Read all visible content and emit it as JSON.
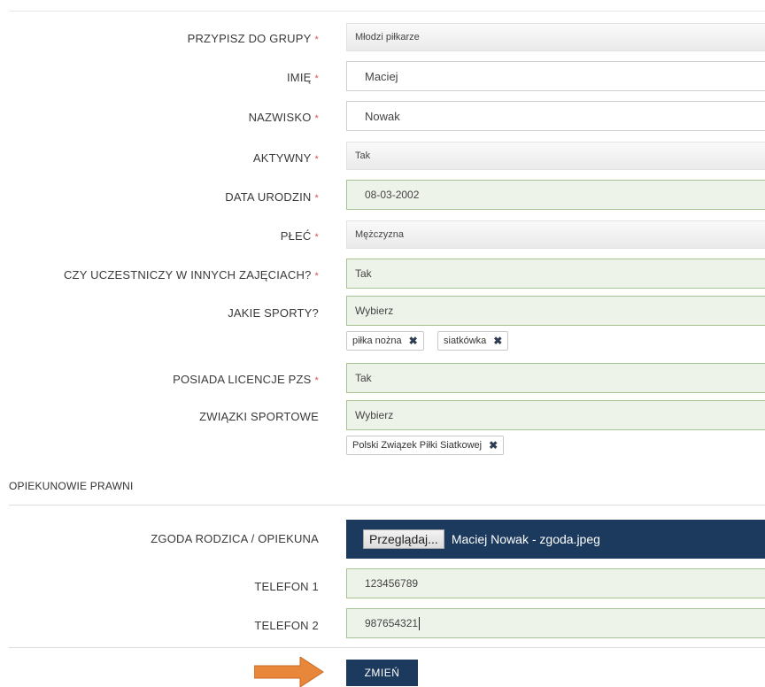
{
  "fields": {
    "group": {
      "label": "PRZYPISZ DO GRUPY",
      "required": "*",
      "value": "Młodzi piłkarze"
    },
    "first_name": {
      "label": "IMIĘ",
      "required": "*",
      "value": "Maciej"
    },
    "last_name": {
      "label": "NAZWISKO",
      "required": "*",
      "value": "Nowak"
    },
    "active": {
      "label": "AKTYWNY",
      "required": "*",
      "value": "Tak"
    },
    "birth_date": {
      "label": "DATA URODZIN",
      "required": "*",
      "value": "08-03-2002"
    },
    "gender": {
      "label": "PŁEĆ",
      "required": "*",
      "value": "Mężczyzna"
    },
    "other_activities": {
      "label": "CZY UCZESTNICZY W INNYCH ZAJĘCIACH?",
      "required": "*",
      "value": "Tak"
    },
    "sports": {
      "label": "JAKIE SPORTY?",
      "placeholder": "Wybierz",
      "tags": [
        "piłka nożna",
        "siatkówka"
      ]
    },
    "pzs_license": {
      "label": "POSIADA LICENCJE PZS",
      "required": "*",
      "value": "Tak"
    },
    "associations": {
      "label": "ZWIĄZKI SPORTOWE",
      "placeholder": "Wybierz",
      "tags": [
        "Polski Związek Piłki Siatkowej"
      ]
    }
  },
  "guardians": {
    "section_title": "OPIEKUNOWIE PRAWNI",
    "consent": {
      "label": "ZGODA RODZICA / OPIEKUNA",
      "browse_label": "Przeglądaj...",
      "file_name": "Maciej Nowak - zgoda.jpeg"
    },
    "phone1": {
      "label": "TELEFON 1",
      "value": "123456789"
    },
    "phone2": {
      "label": "TELEFON 2",
      "value": "987654321"
    }
  },
  "submit_label": "ZMIEŃ",
  "icons": {
    "tag_remove": "close-icon",
    "pointer": "arrow-right-icon"
  },
  "colors": {
    "accent": "#1c3a5e",
    "required": "#d9534f",
    "highlight_arrow": "#e8873a",
    "valid_bg": "#eef3ea",
    "valid_border": "#a7c394"
  }
}
